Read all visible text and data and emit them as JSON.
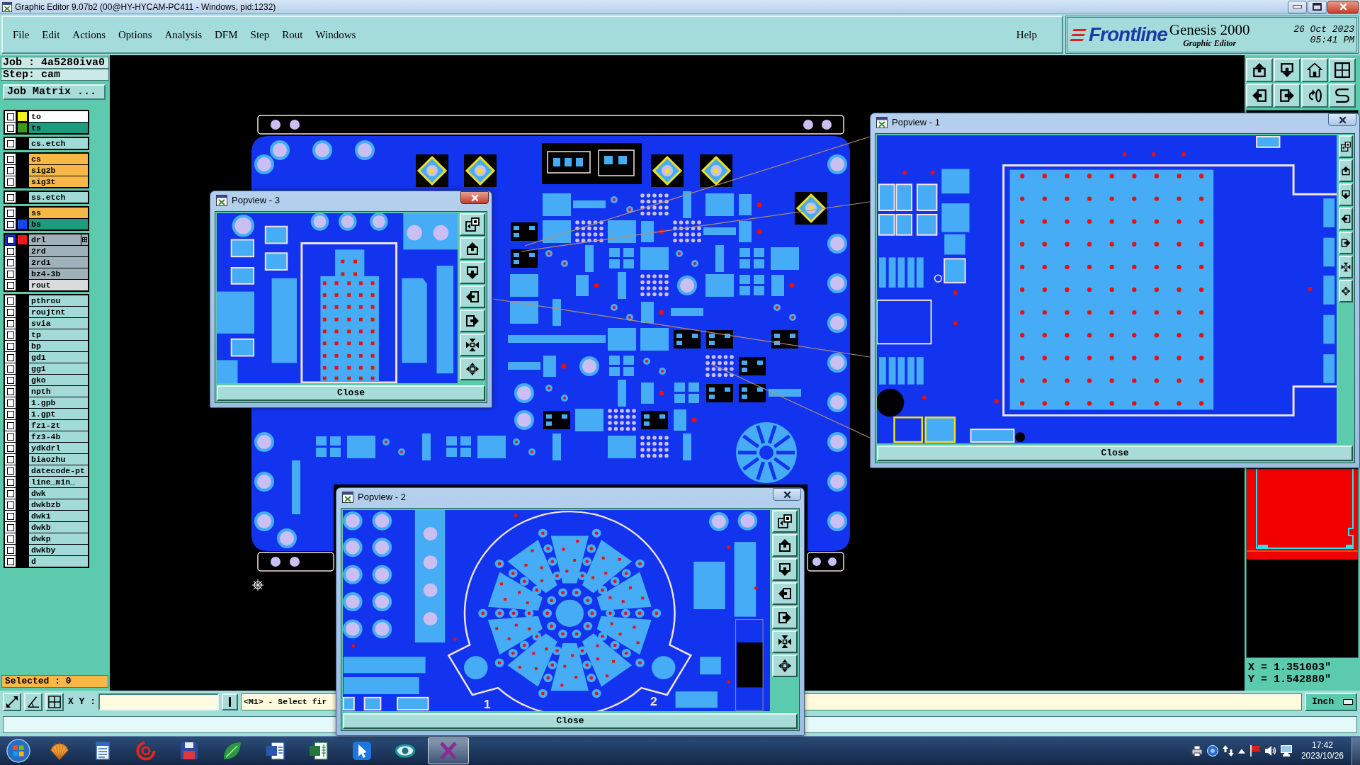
{
  "window": {
    "title": "Graphic Editor 9.07b2 (00@HY-HYCAM-PC411 - Windows, pid:1232)"
  },
  "menu": {
    "items": [
      "File",
      "Edit",
      "Actions",
      "Options",
      "Analysis",
      "DFM",
      "Step",
      "Rout",
      "Windows"
    ],
    "help": "Help"
  },
  "branding": {
    "logo": "Frontline",
    "product": "Genesis 2000",
    "subtitle": "Graphic Editor",
    "date": "26 Oct 2023",
    "time": "05:41 PM"
  },
  "job_panel": {
    "job": "Job : 4a5280iva0",
    "step": "Step: cam",
    "matrix_button": "Job Matrix ..."
  },
  "layer_groups": [
    {
      "layers": [
        {
          "name": "to",
          "kind": "silk",
          "checked": false,
          "selected": false,
          "color": "#f4f018"
        },
        {
          "name": "ts",
          "kind": "mask",
          "checked": false,
          "selected": false,
          "color": "#3c9a14"
        }
      ]
    },
    {
      "layers": [
        {
          "name": "cs.etch",
          "kind": "misc",
          "checked": false,
          "selected": false
        }
      ]
    },
    {
      "layers": [
        {
          "name": "cs",
          "kind": "signal",
          "checked": false,
          "selected": false
        },
        {
          "name": "sig2b",
          "kind": "signal",
          "checked": false,
          "selected": false
        },
        {
          "name": "sig3t",
          "kind": "signal",
          "checked": false,
          "selected": false
        }
      ]
    },
    {
      "layers": [
        {
          "name": "ss.etch",
          "kind": "misc",
          "checked": false,
          "selected": false
        }
      ]
    },
    {
      "layers": [
        {
          "name": "ss",
          "kind": "signal",
          "checked": false,
          "selected": false
        },
        {
          "name": "bs",
          "kind": "mask",
          "checked": false,
          "selected": false,
          "color": "#1446f0"
        }
      ]
    },
    {
      "layers": [
        {
          "name": "drl",
          "kind": "drill",
          "checked": false,
          "selected": true,
          "color": "#f01818"
        },
        {
          "name": "2rd",
          "kind": "drill",
          "checked": false,
          "selected": false
        },
        {
          "name": "2rd1",
          "kind": "drill",
          "checked": false,
          "selected": false
        },
        {
          "name": "bz4-3b",
          "kind": "drill",
          "checked": false,
          "selected": false
        },
        {
          "name": "rout",
          "kind": "rout",
          "checked": false,
          "selected": false
        }
      ]
    },
    {
      "layers": [
        {
          "name": "pthrou",
          "kind": "misc",
          "checked": false,
          "selected": false
        },
        {
          "name": "roujtnt",
          "kind": "misc",
          "checked": false,
          "selected": false
        },
        {
          "name": "svia",
          "kind": "misc",
          "checked": false,
          "selected": false
        },
        {
          "name": "tp",
          "kind": "misc",
          "checked": false,
          "selected": false
        },
        {
          "name": "bp",
          "kind": "misc",
          "checked": false,
          "selected": false
        },
        {
          "name": "gd1",
          "kind": "misc",
          "checked": false,
          "selected": false
        },
        {
          "name": "gg1",
          "kind": "misc",
          "checked": false,
          "selected": false
        },
        {
          "name": "gko",
          "kind": "misc",
          "checked": false,
          "selected": false
        },
        {
          "name": "npth",
          "kind": "misc",
          "checked": false,
          "selected": false
        },
        {
          "name": "1.gpb",
          "kind": "misc",
          "checked": false,
          "selected": false
        },
        {
          "name": "1.gpt",
          "kind": "misc",
          "checked": false,
          "selected": false
        },
        {
          "name": "fz1-2t",
          "kind": "misc",
          "checked": false,
          "selected": false
        },
        {
          "name": "fz3-4b",
          "kind": "misc",
          "checked": false,
          "selected": false
        },
        {
          "name": "ydkdrl",
          "kind": "misc",
          "checked": false,
          "selected": false
        },
        {
          "name": "biaozhu",
          "kind": "misc",
          "checked": false,
          "selected": false
        },
        {
          "name": "datecode-pt",
          "kind": "misc",
          "checked": false,
          "selected": false
        },
        {
          "name": "line_min_",
          "kind": "misc",
          "checked": false,
          "selected": false
        },
        {
          "name": "dwk",
          "kind": "misc",
          "checked": false,
          "selected": false
        },
        {
          "name": "dwkbzb",
          "kind": "misc",
          "checked": false,
          "selected": false
        },
        {
          "name": "dwk1",
          "kind": "misc",
          "checked": false,
          "selected": false
        },
        {
          "name": "dwkb",
          "kind": "misc",
          "checked": false,
          "selected": false
        },
        {
          "name": "dwkp",
          "kind": "misc",
          "checked": false,
          "selected": false
        },
        {
          "name": "dwkby",
          "kind": "misc",
          "checked": false,
          "selected": false
        },
        {
          "name": "d",
          "kind": "misc",
          "checked": false,
          "selected": false
        }
      ]
    }
  ],
  "selected_count": "Selected : 0",
  "coordinates": {
    "x": "X = 1.351003\"",
    "y": "Y = 1.542880\""
  },
  "command_bar": {
    "xy_label": "X Y :",
    "message": "<M1> - Select fir",
    "units": "Inch"
  },
  "popviews": [
    {
      "title": "Popview - 1",
      "kind": "grid-array",
      "active": false,
      "close_button": "Close"
    },
    {
      "title": "Popview - 3",
      "kind": "pad-array",
      "active": true,
      "close_button": "Close"
    },
    {
      "title": "Popview - 2",
      "kind": "radial-pattern",
      "active": false,
      "close_button": "Close",
      "labels": [
        "1",
        "2"
      ]
    }
  ],
  "taskbar": {
    "apps": [
      {
        "selected": false
      },
      {
        "selected": false
      },
      {
        "selected": false
      },
      {
        "selected": false
      },
      {
        "selected": false
      },
      {
        "selected": false
      },
      {
        "selected": false
      },
      {
        "selected": false
      },
      {
        "selected": false
      },
      {
        "selected": true
      }
    ],
    "time": "17:42",
    "date": "2023/10/26"
  }
}
